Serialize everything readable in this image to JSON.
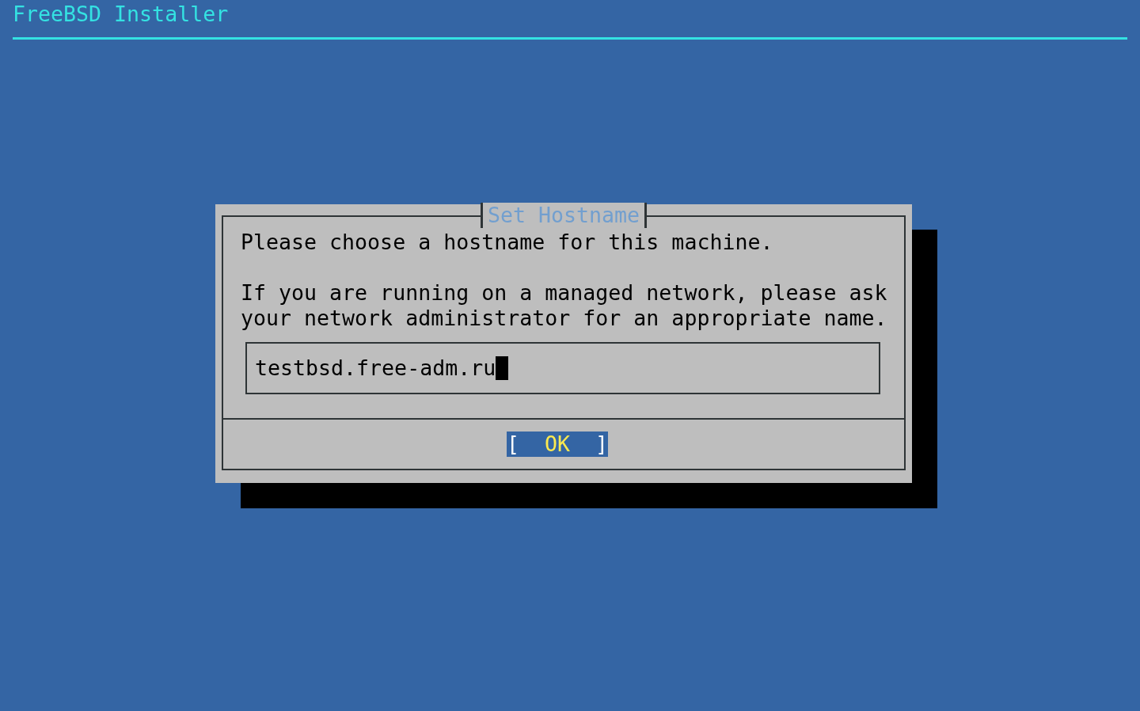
{
  "header": {
    "title": "FreeBSD Installer"
  },
  "dialog": {
    "title": "Set Hostname",
    "paragraphs": [
      "Please choose a hostname for this machine.",
      "If you are running on a managed network, please ask your network administrator for an appropriate name."
    ],
    "input": {
      "value": "testbsd.free-adm.ru",
      "focused": true
    },
    "buttons": [
      {
        "left": "[",
        "label": "OK",
        "right": "]",
        "selected": true
      }
    ]
  }
}
